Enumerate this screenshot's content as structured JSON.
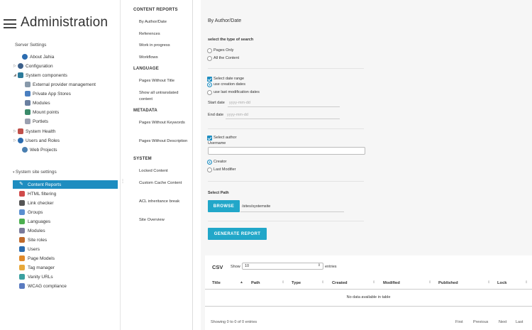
{
  "header": {
    "title": "Administration"
  },
  "server_settings": {
    "label": "Server Settings",
    "items": [
      {
        "label": "About Jahia",
        "icon": "info-icon"
      },
      {
        "label": "Configuration",
        "icon": "gear-icon"
      },
      {
        "label": "System components",
        "icon": "puzzle-icon"
      },
      {
        "label": "External provider management",
        "icon": "server-icon"
      },
      {
        "label": "Private App Stores",
        "icon": "store-icon"
      },
      {
        "label": "Modules",
        "icon": "module-icon"
      },
      {
        "label": "Mount points",
        "icon": "mount-icon"
      },
      {
        "label": "Portlets",
        "icon": "portlet-icon"
      },
      {
        "label": "System Health",
        "icon": "health-icon"
      },
      {
        "label": "Users and Roles",
        "icon": "users-icon"
      },
      {
        "label": "Web Projects",
        "icon": "globe-icon"
      }
    ]
  },
  "site_settings": {
    "label": "System site settings",
    "items": [
      {
        "label": "Content Reports",
        "icon": "wrench-icon",
        "color": "#ffffff"
      },
      {
        "label": "HTML filtering",
        "icon": "code-icon",
        "color": "#d04b4b"
      },
      {
        "label": "Link checker",
        "icon": "link-icon",
        "color": "#555555"
      },
      {
        "label": "Groups",
        "icon": "groups-icon",
        "color": "#5a8fd0"
      },
      {
        "label": "Languages",
        "icon": "languages-icon",
        "color": "#4caf50"
      },
      {
        "label": "Modules",
        "icon": "modules-icon",
        "color": "#7a7a9a"
      },
      {
        "label": "Site roles",
        "icon": "roles-icon",
        "color": "#c06a2b"
      },
      {
        "label": "Users",
        "icon": "user-icon",
        "color": "#2b6cb0"
      },
      {
        "label": "Page Models",
        "icon": "page-models-icon",
        "color": "#e08a2b"
      },
      {
        "label": "Tag manager",
        "icon": "tag-icon",
        "color": "#e8a93b"
      },
      {
        "label": "Vanity URLs",
        "icon": "vanity-icon",
        "color": "#3aa0a0"
      },
      {
        "label": "WCAG compliance",
        "icon": "wcag-icon",
        "color": "#5a7bc0"
      }
    ]
  },
  "reports_nav": {
    "sections": [
      {
        "title": "CONTENT REPORTS",
        "links": [
          "By Author/Date",
          "References",
          "Work in progress",
          "Workflows"
        ]
      },
      {
        "title": "LANGUAGE",
        "links": [
          "Pages Without Title",
          "Show all untranslated content"
        ]
      },
      {
        "title": "METADATA",
        "links": [
          "Pages Without Keywords",
          "Pages Without Description"
        ]
      },
      {
        "title": "SYSTEM",
        "links": [
          "Locked Content",
          "Custom Cache Content",
          "ACL inheritance break",
          "Site Overview"
        ]
      }
    ]
  },
  "form": {
    "page_title": "By Author/Date",
    "search_type_label": "select the type of search",
    "search_type_options": [
      "Pages Only",
      "All the Content"
    ],
    "date_range_label": "Select date range",
    "date_options": [
      "use creation dates",
      "use last modification dates"
    ],
    "start_date_label": "Start date",
    "end_date_label": "End date",
    "date_placeholder": "yyyy-mm-dd",
    "select_author_label": "Select author",
    "username_label": "Username",
    "username_value": "",
    "author_options": [
      "Creator",
      "Last Modifier"
    ],
    "select_path_label": "Select Path",
    "browse_label": "BROWSE",
    "path_value": "/sites/systemsite",
    "generate_label": "GENERATE REPORT"
  },
  "table": {
    "csv_label": "CSV",
    "show_label": "Show",
    "entries_value": "10",
    "entries_label": "entries",
    "columns": [
      "Title",
      "Path",
      "Type",
      "Created",
      "Modified",
      "Published",
      "Lock"
    ],
    "empty_message": "No data available in table",
    "info": "Showing 0 to 0 of 0 entries",
    "pager": [
      "First",
      "Previous",
      "Next",
      "Last"
    ]
  }
}
